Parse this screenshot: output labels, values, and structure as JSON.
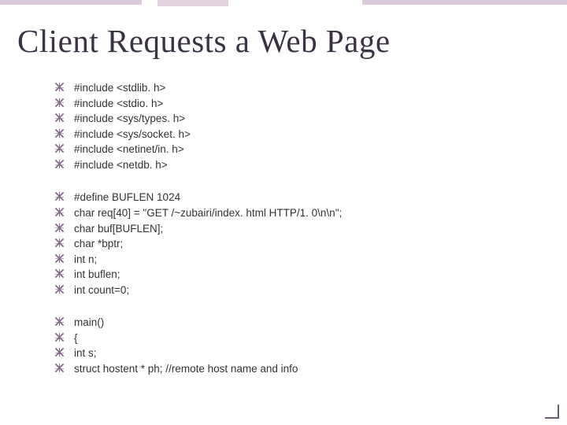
{
  "title": "Client Requests a Web Page",
  "blocks": [
    [
      "#include <stdlib. h>",
      "#include <stdio. h>",
      "#include <sys/types. h>",
      "#include <sys/socket. h>",
      "#include <netinet/in. h>",
      "#include <netdb. h>"
    ],
    [
      "#define BUFLEN 1024",
      "char req[40] = \"GET /~zubairi/index. html HTTP/1. 0\\n\\n\";",
      "char buf[BUFLEN];",
      "char *bptr;",
      "int n;",
      "int buflen;",
      "int count=0;"
    ],
    [
      "main()",
      "{",
      "int s;",
      "struct hostent * ph; //remote host name and info"
    ]
  ]
}
